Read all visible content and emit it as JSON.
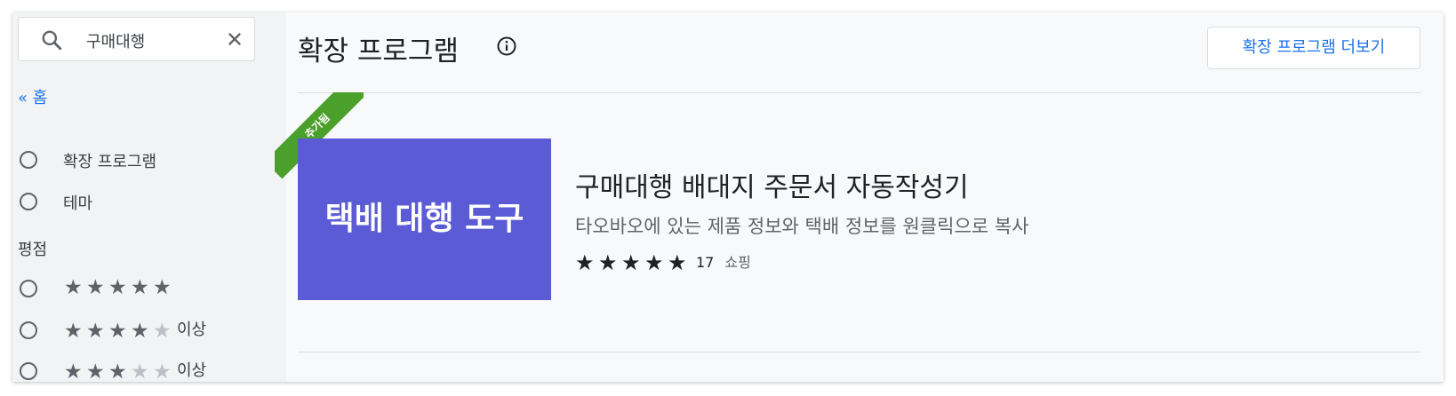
{
  "search": {
    "query": "구매대행"
  },
  "nav": {
    "home_link": "« 홈"
  },
  "filters": {
    "type_options": [
      {
        "label": "확장 프로그램"
      },
      {
        "label": "테마"
      }
    ],
    "rating_heading": "평점",
    "rating_options": [
      {
        "stars": 5,
        "suffix": ""
      },
      {
        "stars": 4,
        "suffix": "이상"
      },
      {
        "stars": 3,
        "suffix": "이상"
      }
    ]
  },
  "main": {
    "title": "확장 프로그램",
    "more_button": "확장 프로그램 더보기"
  },
  "extension": {
    "ribbon": "추가됨",
    "thumbnail_text": "택배 대행 도구",
    "thumbnail_color": "#5b5bd6",
    "title": "구매대행 배대지 주문서 자동작성기",
    "description": "타오바오에 있는 제품 정보와 택배 정보를 원클릭으로 복사",
    "rating": 5,
    "rating_count": "17",
    "category": "쇼핑"
  },
  "colors": {
    "accent": "#1a73e8",
    "ribbon": "#4aa02a",
    "sidebar_bg": "#f1f3f4"
  }
}
